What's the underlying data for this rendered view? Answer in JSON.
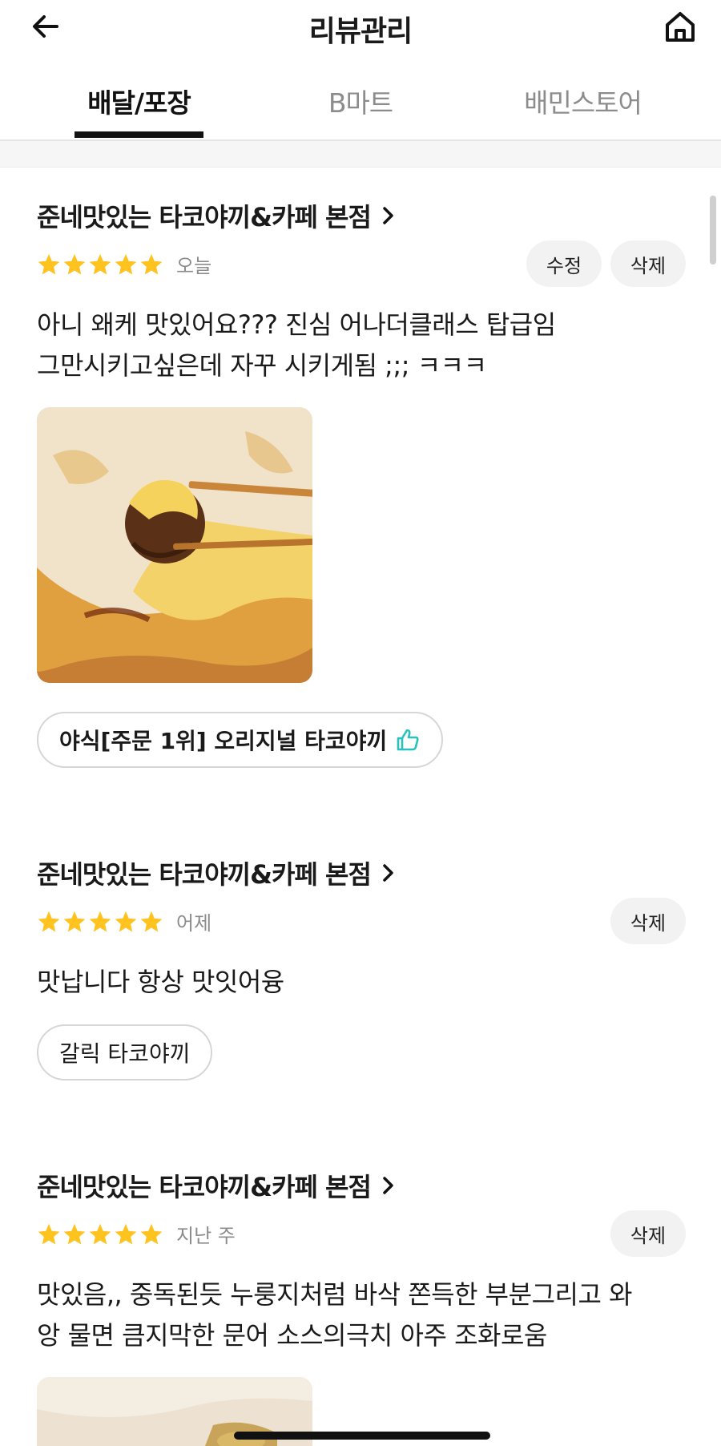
{
  "header": {
    "title": "리뷰관리",
    "back_icon": "arrow-left-icon",
    "home_icon": "home-icon"
  },
  "tabs": [
    {
      "label": "배달/포장",
      "active": true
    },
    {
      "label": "B마트",
      "active": false
    },
    {
      "label": "배민스토어",
      "active": false
    }
  ],
  "colors": {
    "star": "#FFC31F",
    "thumb": "#2AC1BC",
    "pill_bg": "#F2F2F2",
    "border": "#D6D6D6"
  },
  "reviews": [
    {
      "store": "준네맛있는 타코야끼&카페 본점",
      "rating": 5,
      "date": "오늘",
      "edit_label": "수정",
      "delete_label": "삭제",
      "text_lines": [
        "아니 왜케 맛있어요??? 진심 어나더클래스 탑급임",
        "그만시키고싶은데 자꾸 시키게됨 ;;; ㅋㅋㅋ"
      ],
      "menu": "야식[주문 1위] 오리지널 타코야끼"
    },
    {
      "store": "준네맛있는 타코야끼&카페 본점",
      "rating": 5,
      "date": "어제",
      "delete_label": "삭제",
      "text_lines": [
        "맛납니다 항상 맛잇어융"
      ],
      "menu": "갈릭 타코야끼"
    },
    {
      "store": "준네맛있는 타코야끼&카페 본점",
      "rating": 5,
      "date": "지난 주",
      "delete_label": "삭제",
      "text_lines": [
        "맛있음,, 중독된듯 누룽지처럼 바삭 쫀득한 부분그리고 와",
        "앙 물면 큼지막한 문어 소스의극치 아주 조화로움"
      ]
    }
  ]
}
